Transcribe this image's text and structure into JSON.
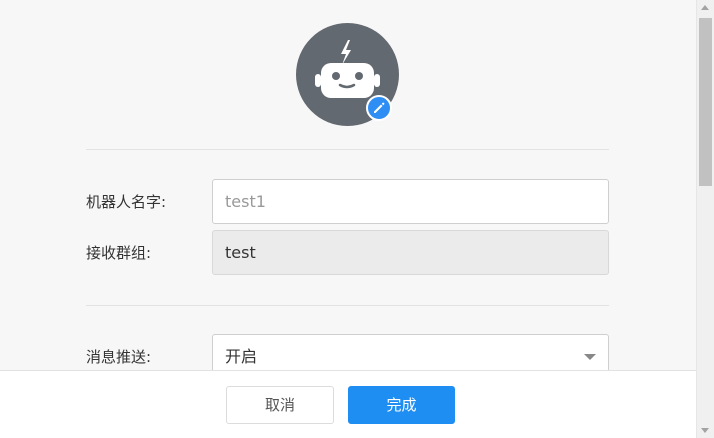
{
  "avatar": {
    "icon": "robot-icon",
    "edit_icon": "pencil-icon",
    "color": "#636970",
    "badge_color": "#2f8ef4"
  },
  "form": {
    "robot_name": {
      "label": "机器人名字:",
      "value": "test1"
    },
    "group": {
      "label": "接收群组:",
      "value": "test"
    },
    "push": {
      "label": "消息推送:",
      "value": "开启"
    }
  },
  "footer": {
    "cancel_label": "取消",
    "done_label": "完成",
    "primary_color": "#1e8ef2"
  }
}
